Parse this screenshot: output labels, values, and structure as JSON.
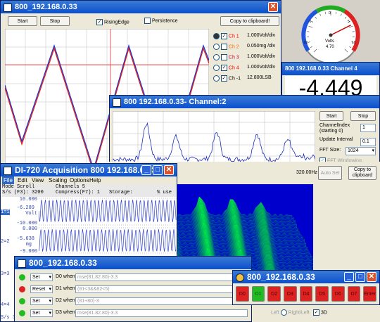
{
  "scope": {
    "title": "800_192.168.0.33",
    "start_label": "Start",
    "stop_label": "Stop",
    "rising_edge_label": "RisingEdge",
    "persistence_label": "Persistence",
    "copy_label": "Copy to clipboard!",
    "channels": [
      {
        "name": "Ch 1",
        "scale": "1.000Volt/div",
        "color": "#ff0000",
        "selected": true
      },
      {
        "name": "Ch 2",
        "scale": "0.050mg  /div",
        "color": "#ff6600",
        "selected": false
      },
      {
        "name": "Ch 3",
        "scale": "1.000Volt/div",
        "color": "#cc0033",
        "selected": false
      },
      {
        "name": "Ch 4",
        "scale": "1.000Volt/div",
        "color": "#ff0000",
        "selected": false
      },
      {
        "name": "Ch -1",
        "scale": "12.800LSB",
        "color": "#000000",
        "selected": false
      }
    ]
  },
  "gauge": {
    "label": "Volts",
    "value": "4.70",
    "needle_value": 4.7,
    "ticks": [
      "-10",
      "-5",
      "0",
      "5",
      "10"
    ]
  },
  "meter": {
    "title": "800 192.168.0.33 Channel 4",
    "value": "-4.449"
  },
  "fft": {
    "title": "800 192.168.0.33- Channel:2",
    "start_label": "Start",
    "stop_label": "Stop",
    "channel_index_label": "ChannelIndex (starting 0)",
    "channel_index_value": "1",
    "update_interval_label": "Update Interval",
    "update_interval_value": "0.1",
    "fft_size_label": "FFT Size:",
    "fft_size_value": "1024",
    "fft_windowing_label": "FFT Windowing",
    "freq_label": "320.00Hz",
    "auto_set_label": "Auto Set",
    "copy_label": "Copy to clipboard",
    "left_label": "Left",
    "right_left_label": "Right/Left",
    "three_d_label": "3D"
  },
  "acq": {
    "title": "DI-720 Acquisition 800 192.168.0.33",
    "menu": [
      "File",
      "Edit",
      "View",
      "Scaling",
      "Options",
      "Help"
    ],
    "info_line1_a": "Mode  Scroll",
    "info_line1_b": "Channels  5",
    "info_line2_a": "S/s (F3): 3200",
    "info_line2_b": "Compress(F7): 1",
    "info_line2_c": "Storage:",
    "info_line2_d": "% use",
    "ch1": {
      "id": "1=1",
      "top": "10.000",
      "mid": "-6.289",
      "unit": "Volt",
      "bottom": "-10.000"
    },
    "ch2": {
      "id": "2=2",
      "top": "8.000",
      "mid": "-5.638",
      "unit": "mg",
      "bottom": "-9.000"
    },
    "ch3": {
      "id": "3=3"
    },
    "ch4": {
      "id": "4=4"
    },
    "foot": "S/s 3"
  },
  "dout": {
    "title": "800_192.168.0.33",
    "rows": [
      {
        "color": "#22bb22",
        "action": "Set",
        "label": "D0 when",
        "expr": "mse(81.82.80)-3.3"
      },
      {
        "color": "#dd2222",
        "action": "Reset",
        "label": "D1 when",
        "expr": "(81<3&&82<5)"
      },
      {
        "color": "#22bb22",
        "action": "Set",
        "label": "D2 when",
        "expr": "(81+80)-3"
      },
      {
        "color": "#22bb22",
        "action": "Set",
        "label": "D3 when",
        "expr": "mse(81.82.80)-3.3"
      }
    ]
  },
  "leds": {
    "title": "800_192.168.0.33",
    "buttons": [
      {
        "label": "D0",
        "color": "#dd2222"
      },
      {
        "label": "D1",
        "color": "#22bb22"
      },
      {
        "label": "D2",
        "color": "#dd2222"
      },
      {
        "label": "D3",
        "color": "#dd2222"
      },
      {
        "label": "D4",
        "color": "#dd2222"
      },
      {
        "label": "D5",
        "color": "#dd2222"
      },
      {
        "label": "D6",
        "color": "#dd2222"
      },
      {
        "label": "D7",
        "color": "#dd2222"
      },
      {
        "label": "Enter",
        "color": "#dd2222"
      }
    ]
  }
}
